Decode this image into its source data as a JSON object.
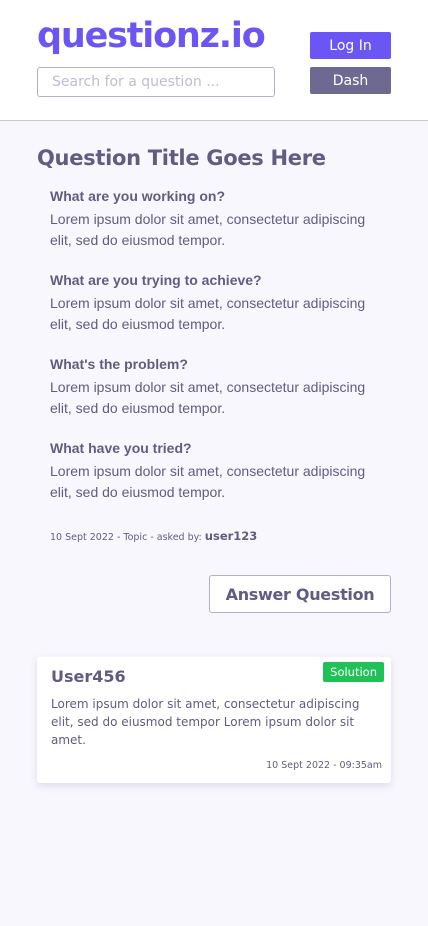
{
  "header": {
    "logo": "questionz.io",
    "search_placeholder": "Search for a question ...",
    "login_label": "Log In",
    "dash_label": "Dash"
  },
  "question": {
    "title": "Question Title Goes Here",
    "sections": [
      {
        "q": "What are you working on?",
        "a": "Lorem ipsum dolor sit amet, consectetur adipiscing elit, sed do eiusmod tempor."
      },
      {
        "q": "What are you trying to achieve?",
        "a": "Lorem ipsum dolor sit amet, consectetur adipiscing elit, sed do eiusmod tempor."
      },
      {
        "q": "What's the problem?",
        "a": "Lorem ipsum dolor sit amet, consectetur adipiscing elit, sed do eiusmod tempor."
      },
      {
        "q": "What have you tried?",
        "a": "Lorem ipsum dolor sit amet, consectetur adipiscing elit, sed do eiusmod tempor."
      }
    ],
    "meta_text": "10 Sept 2022 - Topic - asked by:",
    "asked_by": "user123"
  },
  "answer_button_label": "Answer Question",
  "answer": {
    "user": "User456",
    "badge": "Solution",
    "body": "Lorem ipsum dolor sit amet, consectetur adipiscing elit, sed do eiusmod tempor Lorem ipsum dolor sit amet.",
    "timestamp": "10 Sept 2022  - 09:35am"
  },
  "colors": {
    "brand": "#6b55f4",
    "dash": "#6d6990",
    "text": "#615c80",
    "solution": "#20c157",
    "background": "#f8f7fd"
  }
}
